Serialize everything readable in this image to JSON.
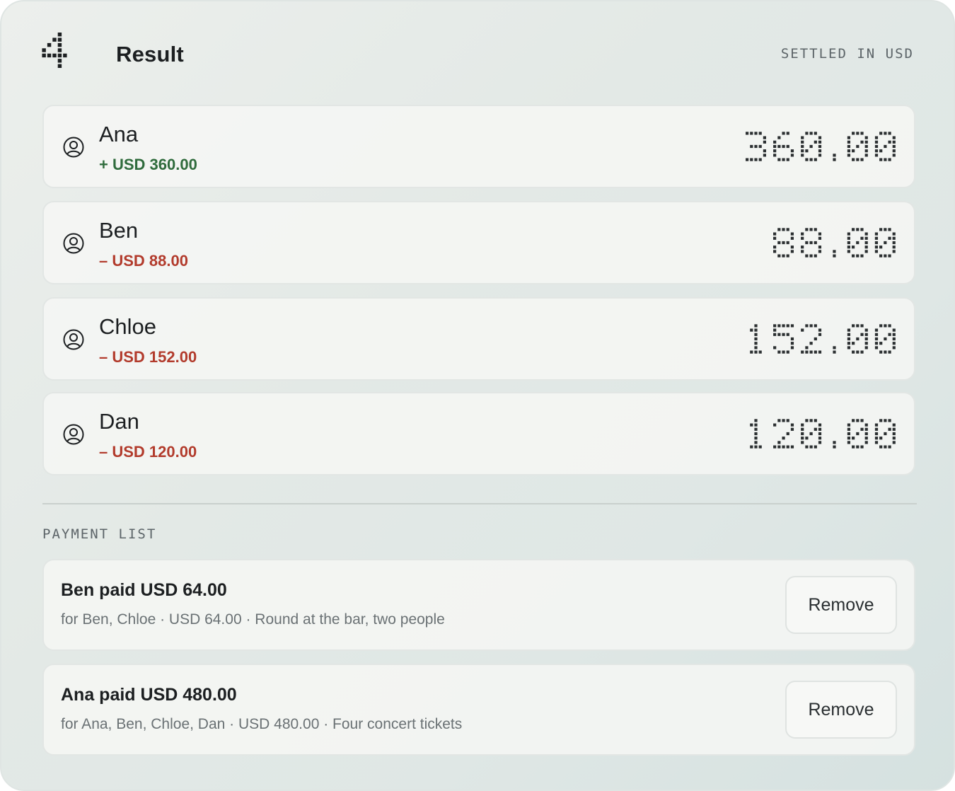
{
  "header": {
    "step_number": "4",
    "title": "Result",
    "settled_label": "SETTLED IN USD"
  },
  "people": [
    {
      "name": "Ana",
      "balance_text": "+ USD 360.00",
      "sign": "positive",
      "amount_display": "360.00",
      "avatar_icon": "user-circle-icon"
    },
    {
      "name": "Ben",
      "balance_text": "– USD 88.00",
      "sign": "negative",
      "amount_display": "88.00",
      "avatar_icon": "user-circle-icon"
    },
    {
      "name": "Chloe",
      "balance_text": "– USD 152.00",
      "sign": "negative",
      "amount_display": "152.00",
      "avatar_icon": "user-circle-icon"
    },
    {
      "name": "Dan",
      "balance_text": "– USD 120.00",
      "sign": "negative",
      "amount_display": "120.00",
      "avatar_icon": "user-circle-icon"
    }
  ],
  "payment_list": {
    "label": "PAYMENT LIST",
    "items": [
      {
        "title": "Ben paid USD 64.00",
        "detail": "for Ben, Chloe · USD 64.00 · Round at the bar, two people",
        "remove_label": "Remove"
      },
      {
        "title": "Ana paid USD 480.00",
        "detail": "for Ana, Ben, Chloe, Dan · USD 480.00 · Four concert tickets",
        "remove_label": "Remove"
      }
    ]
  },
  "colors": {
    "positive": "#2f6b3c",
    "negative": "#b23b2c",
    "text": "#1c1f21",
    "muted": "#6a7174"
  }
}
